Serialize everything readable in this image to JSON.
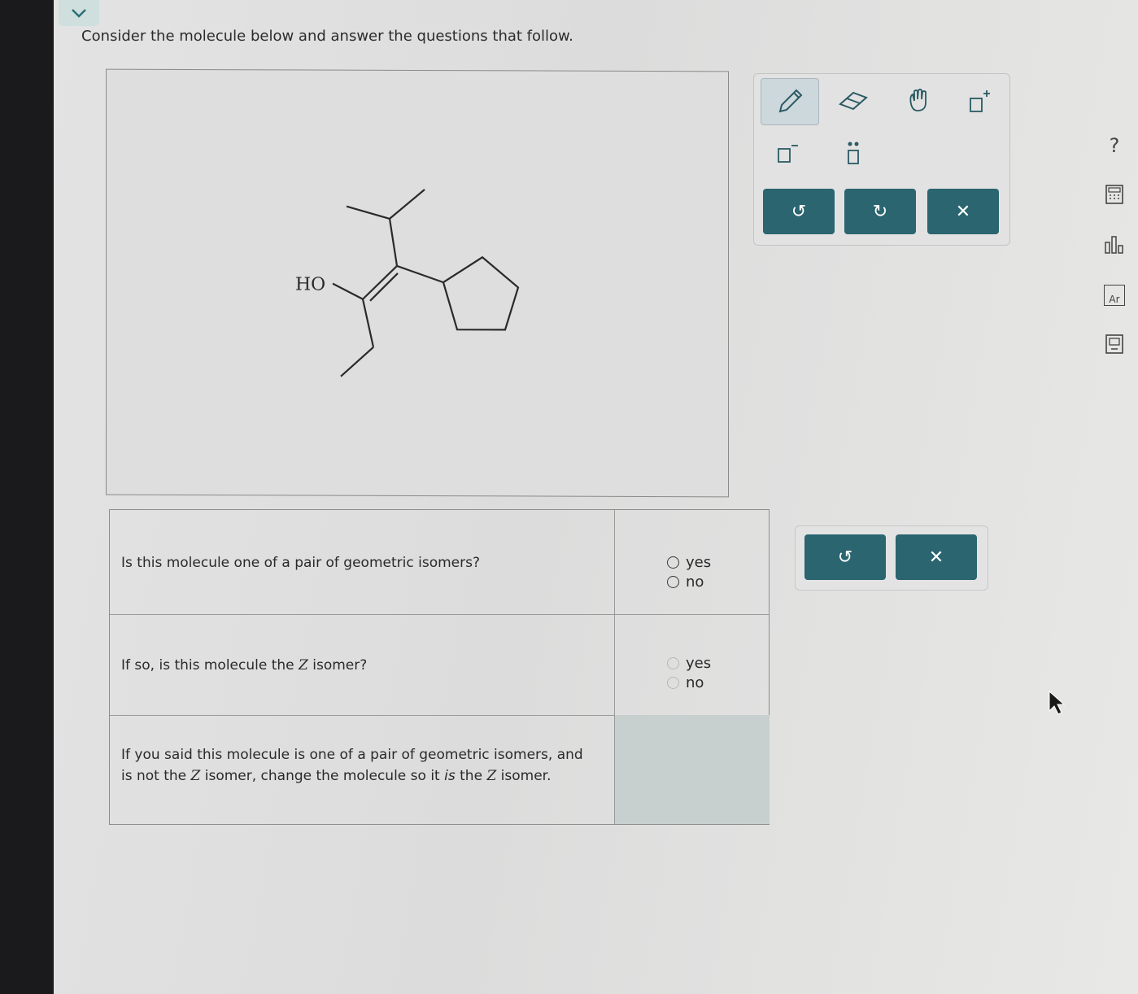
{
  "prompt": "Consider the molecule below and answer the questions that follow.",
  "molecule": {
    "label_ho": "HO"
  },
  "toolbar": {
    "tools": [
      "pencil-icon",
      "eraser-icon",
      "hand-icon",
      "charge-plus-icon",
      "charge-minus-icon",
      "lone-pair-icon"
    ],
    "undo_label": "↺",
    "redo_label": "↻",
    "clear_label": "✕"
  },
  "questions": [
    {
      "text": "Is this molecule one of a pair of geometric isomers?",
      "options": [
        "yes",
        "no"
      ]
    },
    {
      "text_before": "If so, is this molecule the ",
      "z": "Z",
      "text_after": " isomer?",
      "options": [
        "yes",
        "no"
      ]
    },
    {
      "line1": "If you said this molecule is one of a pair of geometric isomers, and",
      "line2_a": "is not the ",
      "line2_z": "Z",
      "line2_b": " isomer, change the molecule so it ",
      "line2_is": "is",
      "line2_c": " the ",
      "line2_z2": "Z",
      "line2_d": " isomer."
    }
  ],
  "answer_toolbar": {
    "undo_label": "↺",
    "clear_label": "✕"
  },
  "side_tools": [
    "help-icon",
    "calculator-icon",
    "chart-icon",
    "periodic-table-icon",
    "ebook-icon"
  ],
  "help_label": "?",
  "periodic_label": "Ar"
}
